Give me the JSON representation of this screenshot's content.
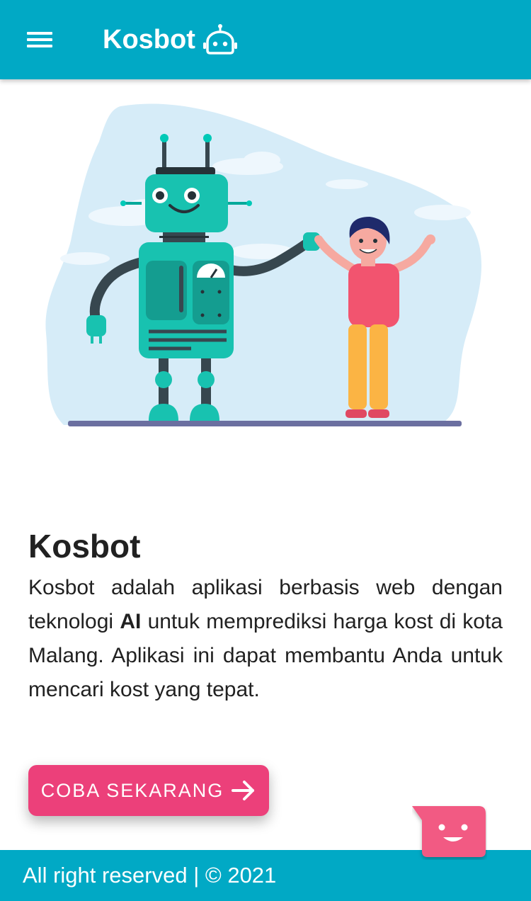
{
  "header": {
    "brand_name": "Kosbot",
    "menu_icon": "hamburger-menu-icon",
    "brand_icon": "robot-icon",
    "background_color": "#01a9c5"
  },
  "hero": {
    "illustration": "robot-and-child-high-five-illustration"
  },
  "main": {
    "title": "Kosbot",
    "description_part1": "Kosbot adalah aplikasi berbasis web dengan teknologi ",
    "description_bold": "AI",
    "description_part2": " untuk memprediksi harga kost di kota Malang. Aplikasi ini dapat membantu Anda untuk mencari kost yang tepat."
  },
  "cta": {
    "label": "COBA SEKARANG",
    "icon": "arrow-right-icon",
    "color": "#ec407a"
  },
  "chat_widget": {
    "icon": "smiley-chat-bubble-icon",
    "color": "#f25a83"
  },
  "footer": {
    "text": "All right reserved | © 2021",
    "background_color": "#01a9c5"
  }
}
